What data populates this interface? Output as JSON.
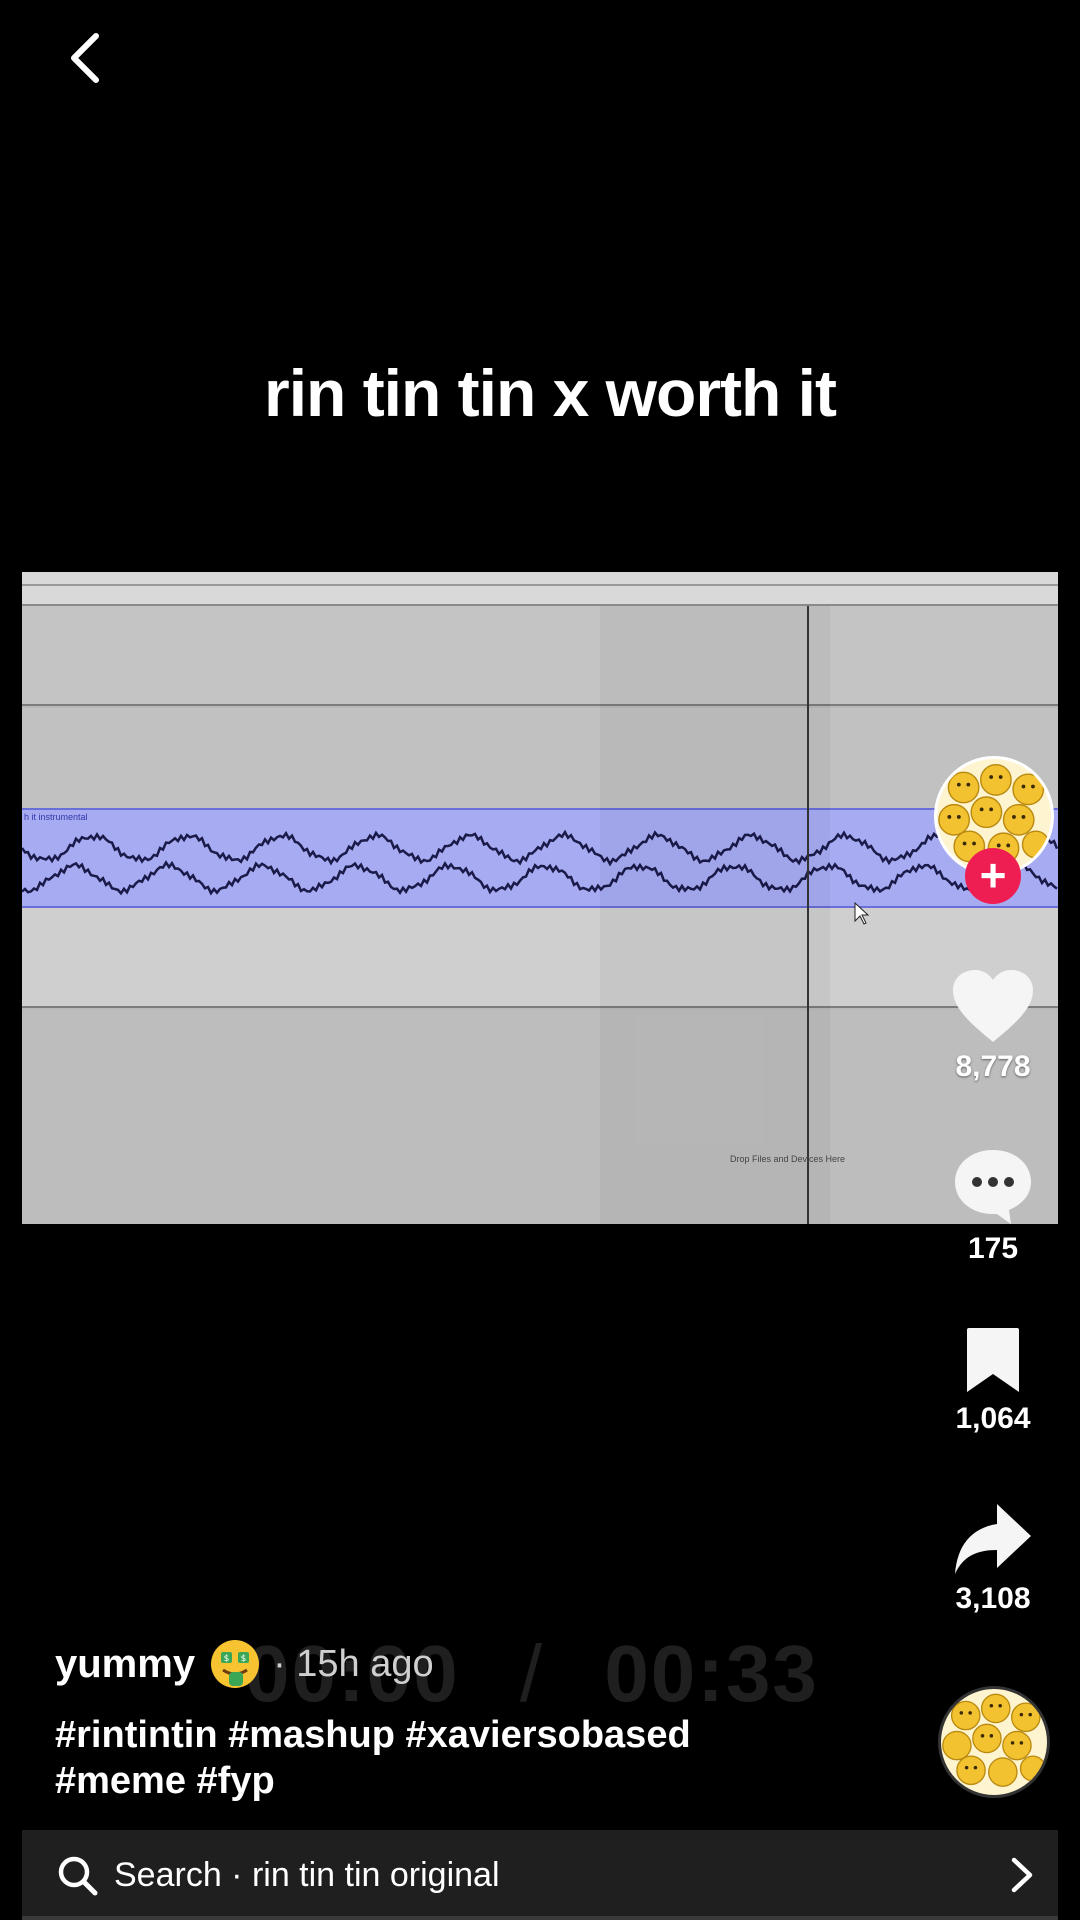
{
  "video": {
    "title_overlay": "rin tin tin x worth it",
    "daw": {
      "clip_label": "h it instrumental",
      "drop_hint": "Drop Files and Devices Here",
      "clip_color": "#a7abf2"
    },
    "playback": {
      "elapsed": "00:00",
      "separator": "/",
      "duration": "00:33",
      "progress": 0.0
    }
  },
  "actions": {
    "likes": "8,778",
    "comments": "175",
    "bookmarks": "1,064",
    "shares": "3,108",
    "follow_symbol": "+",
    "accent_color": "#ee1d52"
  },
  "post": {
    "author": "yummy",
    "author_emoji": "money-mouth-face",
    "time_ago": "· 15h ago",
    "hashtags": "#rintintin #mashup #xaviersobased #meme #fyp"
  },
  "search": {
    "label": "Search · rin tin tin original"
  },
  "icons": [
    "back-chevron-icon",
    "heart-icon",
    "comment-icon",
    "bookmark-icon",
    "share-icon",
    "search-icon",
    "chevron-right-icon"
  ]
}
